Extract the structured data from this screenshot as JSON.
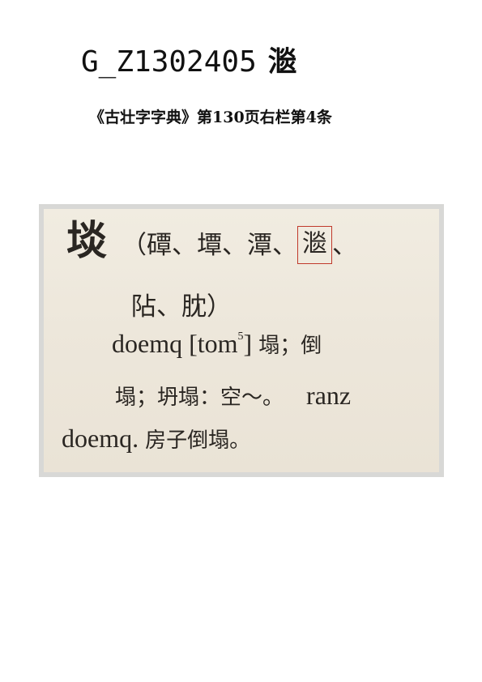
{
  "header": {
    "code": "G_Z1302405",
    "glyph": "㴴"
  },
  "source": {
    "citation": "《古壮字字典》第130页右栏第4条"
  },
  "entry": {
    "headword": "埮",
    "variants_open": "（磹、墰、潭、",
    "variant_highlight": "㴴",
    "variants_close": "、",
    "line2": "阽、䏙）",
    "romanization": "doemq",
    "ipa_open": "[tom",
    "ipa_tone": "5",
    "ipa_close": "]",
    "gloss1": "塌；倒",
    "gloss2": "塌；坍塌：",
    "example_short": "空～。",
    "example_latin": "ranz",
    "example_latin2": "doemq.",
    "example_gloss": "房子倒塌。"
  },
  "colors": {
    "highlight_box": "#c0392b",
    "paper": "#ede7db"
  }
}
